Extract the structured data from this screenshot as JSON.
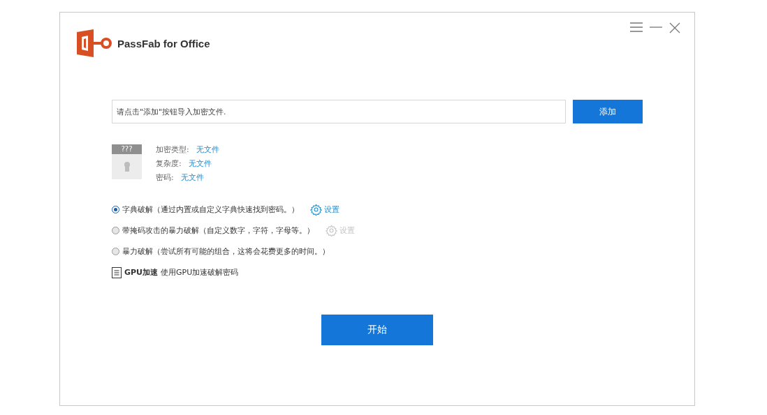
{
  "window": {
    "title": "PassFab for Office"
  },
  "file_input": {
    "placeholder": "请点击\"添加\"按钮导入加密文件."
  },
  "add_button": "添加",
  "file_info": {
    "thumbnail_label": "???",
    "fields": [
      {
        "label": "加密类型:",
        "value": "无文件"
      },
      {
        "label": "复杂度:",
        "value": "无文件"
      },
      {
        "label": "密码:",
        "value": "无文件"
      }
    ]
  },
  "attack_modes": [
    {
      "label": "字典破解（通过内置或自定义字典快速找到密码。）",
      "selected": true,
      "settings": {
        "label": "设置",
        "disabled": false
      }
    },
    {
      "label": "带掩码攻击的暴力破解（自定义数字，字符，字母等。）",
      "selected": false,
      "settings": {
        "label": "设置",
        "disabled": true
      }
    },
    {
      "label": "暴力破解（尝试所有可能的组合，这将会花费更多的时间。）",
      "selected": false
    }
  ],
  "gpu": {
    "title": "GPU加速",
    "description": "使用GPU加速破解密码"
  },
  "start_button": "开始"
}
